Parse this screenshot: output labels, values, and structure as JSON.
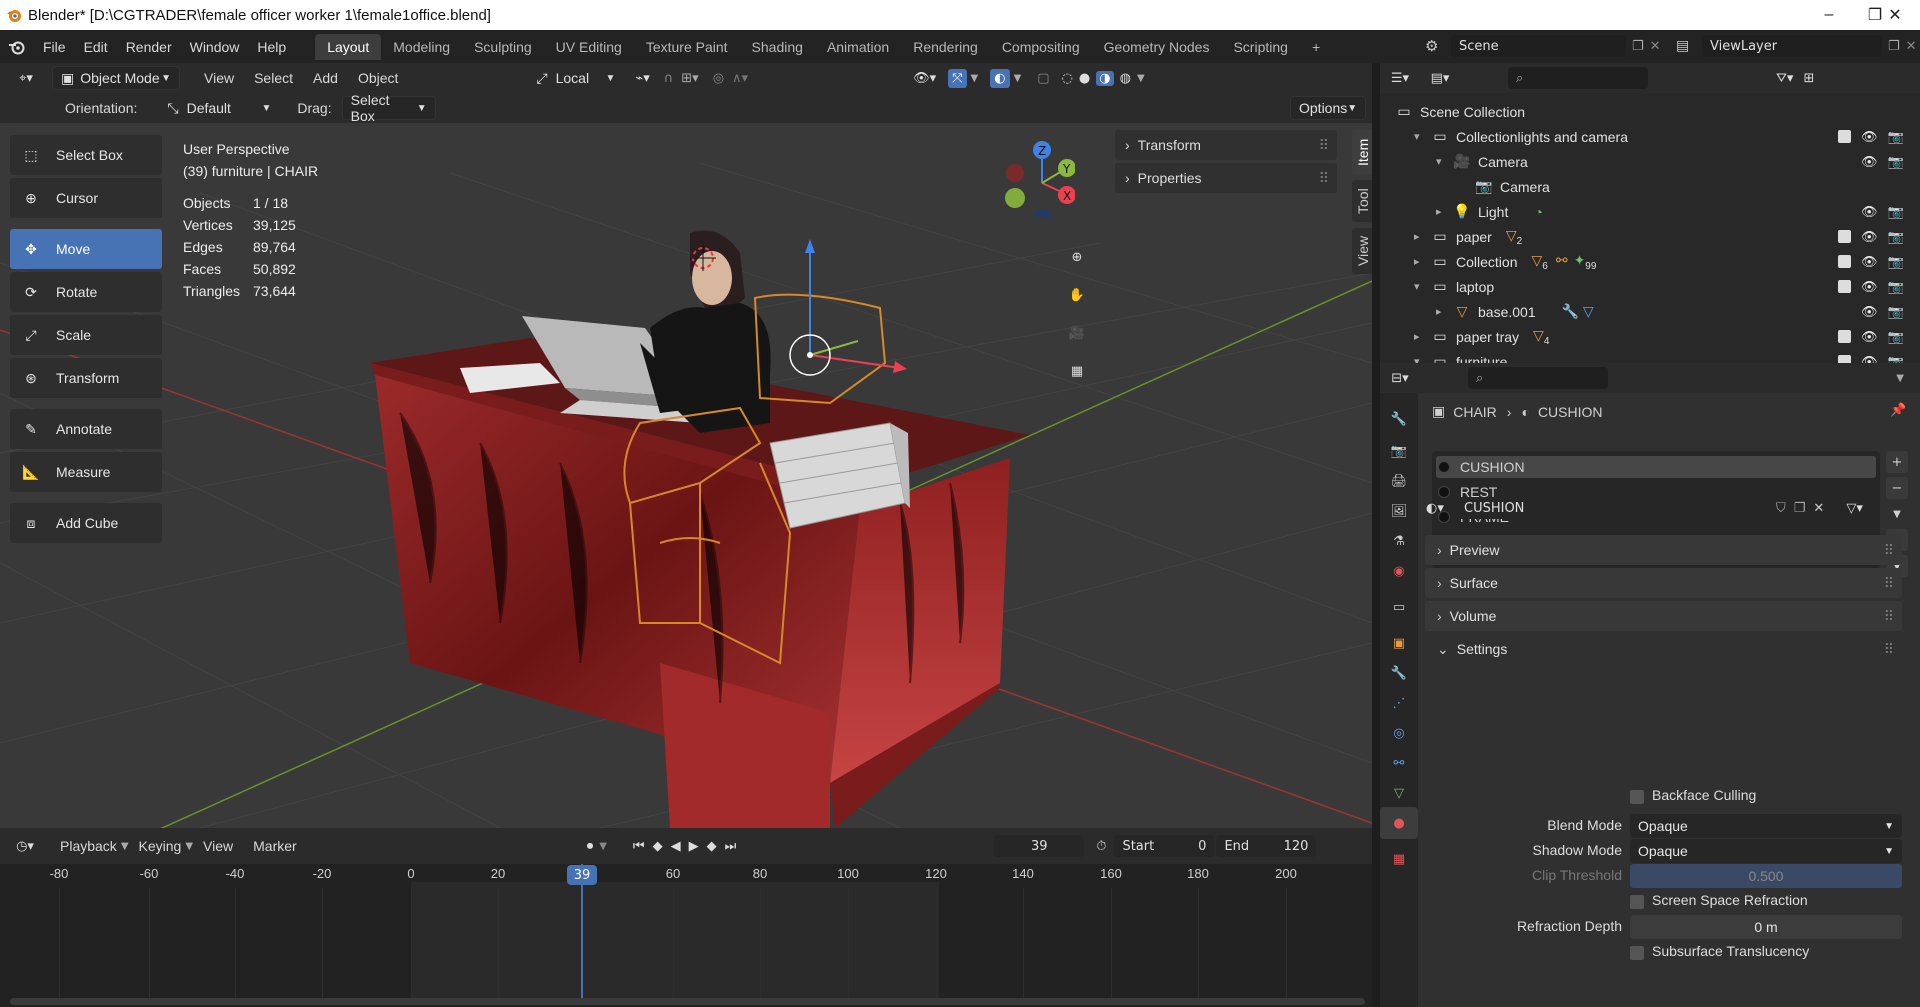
{
  "titlebar": {
    "title": "Blender* [D:\\CGTRADER\\female officer worker 1\\female1office.blend]",
    "minimize": "–",
    "maximize": "❐",
    "close": "✕"
  },
  "menubar": {
    "items": [
      "File",
      "Edit",
      "Render",
      "Window",
      "Help"
    ]
  },
  "workspaces": [
    "Layout",
    "Modeling",
    "Sculpting",
    "UV Editing",
    "Texture Paint",
    "Shading",
    "Animation",
    "Rendering",
    "Compositing",
    "Geometry Nodes",
    "Scripting",
    "+"
  ],
  "scene": {
    "name": "Scene",
    "view_layer": "ViewLayer"
  },
  "viewport_header": {
    "mode": "Object Mode",
    "menus": [
      "View",
      "Select",
      "Add",
      "Object"
    ],
    "pivot": "Local",
    "orientation_label": "Orientation:",
    "orientation_value": "Default",
    "drag_label": "Drag:",
    "drag_value": "Select Box",
    "options": "Options"
  },
  "tools": [
    "Select Box",
    "Cursor",
    "Move",
    "Rotate",
    "Scale",
    "Transform",
    "Annotate",
    "Measure",
    "Add Cube"
  ],
  "active_tool": "Move",
  "viewport_info": {
    "perspective": "User Perspective",
    "object": "(39) furniture | CHAIR"
  },
  "stats": [
    {
      "k": "Objects",
      "v": "1 / 18"
    },
    {
      "k": "Vertices",
      "v": "39,125"
    },
    {
      "k": "Edges",
      "v": "89,764"
    },
    {
      "k": "Faces",
      "v": "50,892"
    },
    {
      "k": "Triangles",
      "v": "73,644"
    }
  ],
  "npanel": {
    "sections": [
      "Transform",
      "Properties"
    ],
    "tabs": [
      "Item",
      "Tool",
      "View"
    ]
  },
  "gizmo": {
    "x": "X",
    "y": "Y",
    "z": "Z",
    "colors": {
      "x": "#e8414f",
      "y": "#8ab93e",
      "z": "#3f83e8"
    }
  },
  "timeline": {
    "menus": [
      "Playback",
      "Keying",
      "View",
      "Marker"
    ],
    "current_frame": "39",
    "start_label": "Start",
    "start": "0",
    "end_label": "End",
    "end": "120",
    "ticks": [
      "-80",
      "-60",
      "-40",
      "-20",
      "0",
      "20",
      "39",
      "60",
      "80",
      "100",
      "120",
      "140",
      "160",
      "180",
      "200"
    ]
  },
  "outliner": {
    "search_placeholder": "",
    "rows": [
      {
        "label": "Scene Collection",
        "depth": 0
      },
      {
        "label": "Collectionlights and camera",
        "depth": 1
      },
      {
        "label": "Camera",
        "depth": 2
      },
      {
        "label": "Camera",
        "depth": 3
      },
      {
        "label": "Light",
        "depth": 2
      },
      {
        "label": "paper",
        "depth": 1,
        "badge": "2"
      },
      {
        "label": "Collection",
        "depth": 1,
        "badge": "6",
        "badge2": "99"
      },
      {
        "label": "laptop",
        "depth": 1
      },
      {
        "label": "base.001",
        "depth": 2
      },
      {
        "label": "paper tray",
        "depth": 1,
        "badge": "4"
      },
      {
        "label": "furniture",
        "depth": 1
      }
    ]
  },
  "properties": {
    "breadcrumb": [
      "CHAIR",
      "CUSHION"
    ],
    "slots": [
      "CUSHION",
      "REST",
      "FRAME"
    ],
    "material_name": "CUSHION",
    "panels": [
      "Preview",
      "Surface",
      "Volume",
      "Settings"
    ],
    "settings": {
      "backface_culling": "Backface Culling",
      "blend_mode_label": "Blend Mode",
      "blend_mode": "Opaque",
      "shadow_mode_label": "Shadow Mode",
      "shadow_mode": "Opaque",
      "clip_label": "Clip Threshold",
      "clip_value": "0.500",
      "ssr": "Screen Space Refraction",
      "refraction_label": "Refraction Depth",
      "refraction_value": "0 m",
      "sss": "Subsurface Translucency"
    }
  },
  "accent": "#4772b3"
}
